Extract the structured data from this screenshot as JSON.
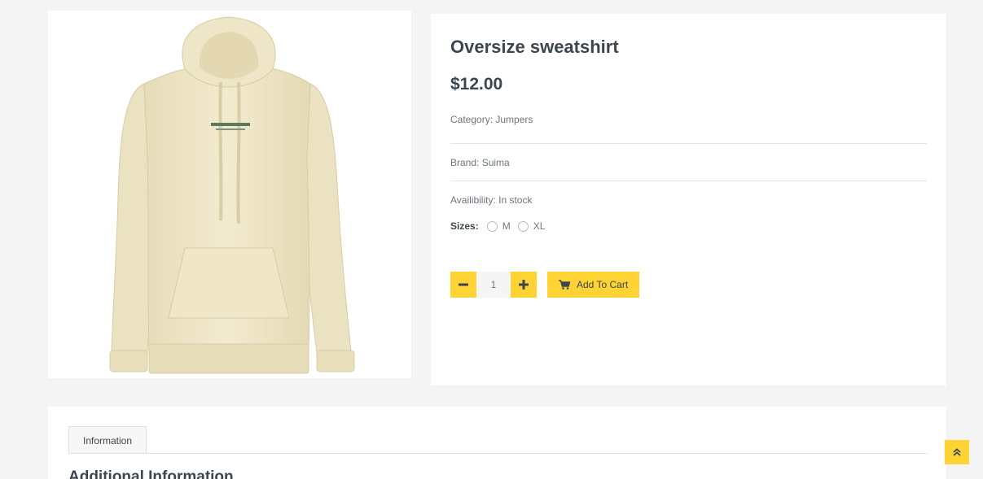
{
  "product": {
    "image_alt": "Cream oversize hooded sweatshirt",
    "title": "Oversize sweatshirt",
    "price": "$12.00",
    "category_text": "Category: Jumpers",
    "brand_text": "Brand: Suima",
    "availability_text": "Availibility: In stock",
    "sizes_label": "Sizes:",
    "sizes": [
      "M",
      "XL"
    ],
    "quantity": "1",
    "add_to_cart_label": "Add To Cart"
  },
  "info": {
    "tab_label": "Information",
    "heading": "Additional Information"
  },
  "colors": {
    "accent": "#ffd333",
    "page_bg": "#f4f4f4",
    "card_bg": "#ffffff",
    "text": "#3d464d",
    "muted": "#6c757d",
    "sweatshirt": "#f1e9cc"
  },
  "icons": {
    "minus": "minus-icon",
    "plus": "plus-icon",
    "cart": "shopping-cart-icon",
    "back_to_top": "double-chevron-up-icon"
  }
}
